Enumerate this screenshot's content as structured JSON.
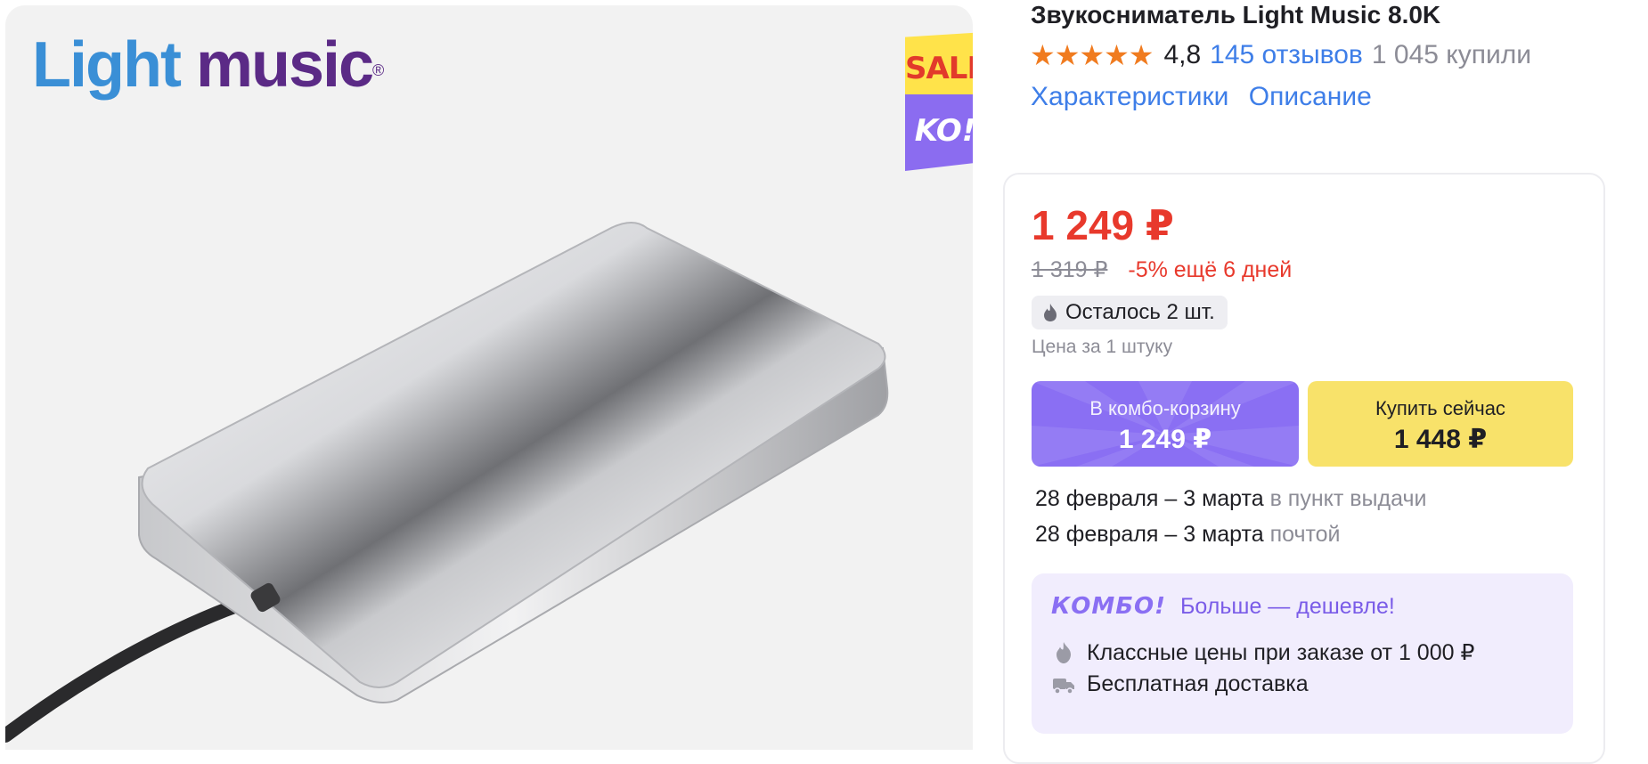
{
  "brand": {
    "word1": "Light",
    "word2": "music",
    "reg": "®"
  },
  "badge": {
    "sale": "SALE",
    "ko": "KO!"
  },
  "product": {
    "title": "Звукосниматель Light Music 8.0K",
    "stars": "★★★★★",
    "rating": "4,8",
    "reviews": "145 отзывов",
    "bought": "1 045 купили"
  },
  "tabs": [
    "Характеристики",
    "Описание"
  ],
  "pricing": {
    "price": "1 249 ₽",
    "old_price": "1 319 ₽",
    "discount": "-5% ещё 6 дней",
    "stock": "Осталось 2 шт.",
    "unit_note": "Цена за 1 штуку"
  },
  "buttons": {
    "combo_label": "В комбо-корзину",
    "combo_price": "1 249 ₽",
    "buy_label": "Купить сейчас",
    "buy_price": "1 448 ₽"
  },
  "delivery": [
    {
      "dates": "28 февраля – 3 марта",
      "method": "в пункт выдачи"
    },
    {
      "dates": "28 февраля – 3 марта",
      "method": "почтой"
    }
  ],
  "combo": {
    "logo": "КОМБО!",
    "tagline": "Больше — дешевле!",
    "lines": [
      "Классные цены при заказе от 1 000 ₽",
      "Бесплатная доставка"
    ]
  },
  "colors": {
    "price_red": "#e8392c",
    "link_blue": "#3e7ee8",
    "combo_purple": "#8a6ff3",
    "buy_yellow": "#f8e26a",
    "star_orange": "#f07b1f"
  }
}
